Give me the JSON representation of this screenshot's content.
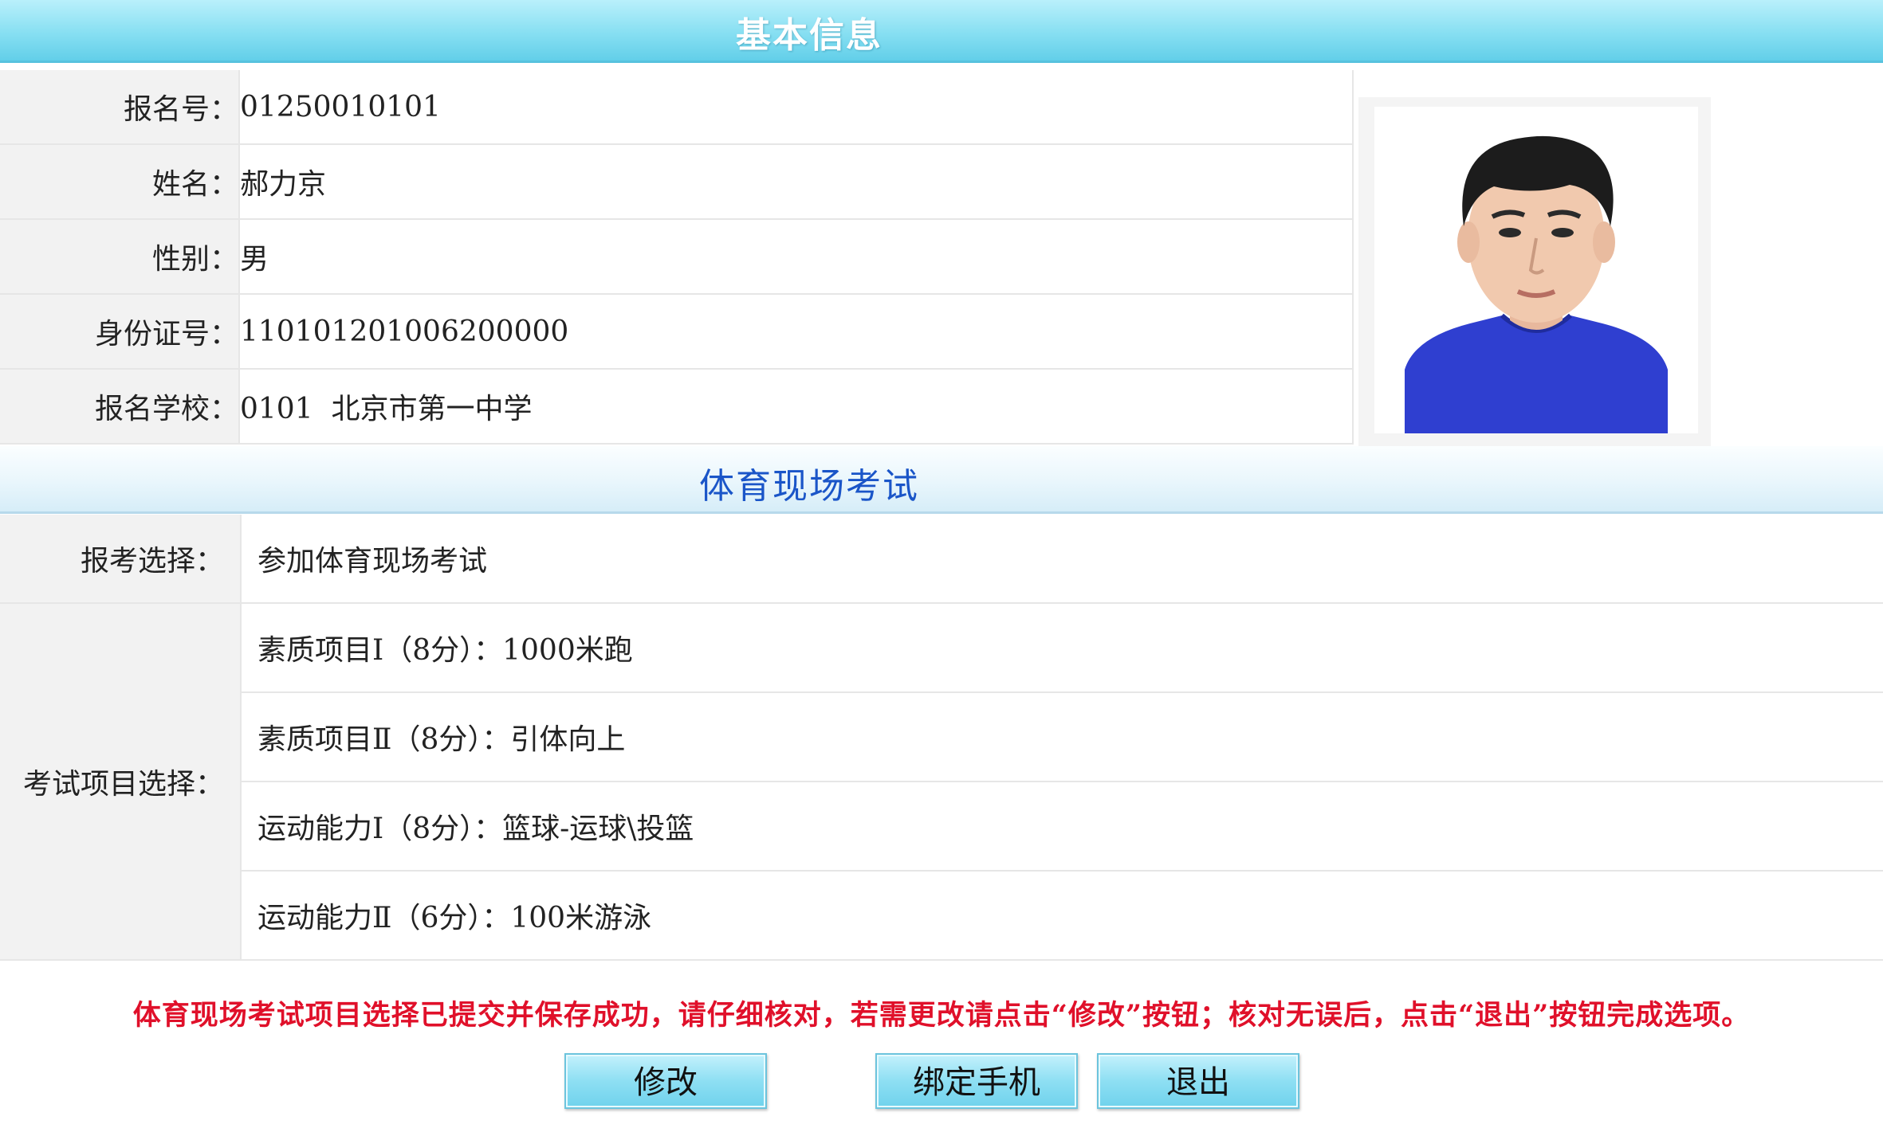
{
  "header": {
    "title": "基本信息"
  },
  "basic_info": [
    {
      "label": "报名号：",
      "value": "01250010101"
    },
    {
      "label": "姓名：",
      "value": "郝力京"
    },
    {
      "label": "性别：",
      "value": "男"
    },
    {
      "label": "身份证号：",
      "value": "110101201006200000"
    },
    {
      "label": "报名学校：",
      "value": "0101  北京市第一中学"
    }
  ],
  "section": {
    "title": "体育现场考试"
  },
  "exam": {
    "choice_label": "报考选择：",
    "choice_value": "参加体育现场考试",
    "items_label": "考试项目选择：",
    "items": [
      "素质项目Ⅰ（8分）：1000米跑",
      "素质项目Ⅱ（8分）：引体向上",
      "运动能力Ⅰ（8分）：篮球-运球\\投篮",
      "运动能力Ⅱ（6分）：100米游泳"
    ]
  },
  "notice": "体育现场考试项目选择已提交并保存成功，请仔细核对，若需更改请点击“修改”按钮；核对无误后，点击“退出”按钮完成选项。",
  "buttons": {
    "modify": "修改",
    "bind_phone": "绑定手机",
    "exit": "退出"
  },
  "colors": {
    "header": "#87dff2",
    "section_title": "#1a55c8",
    "notice": "#e0102a"
  }
}
